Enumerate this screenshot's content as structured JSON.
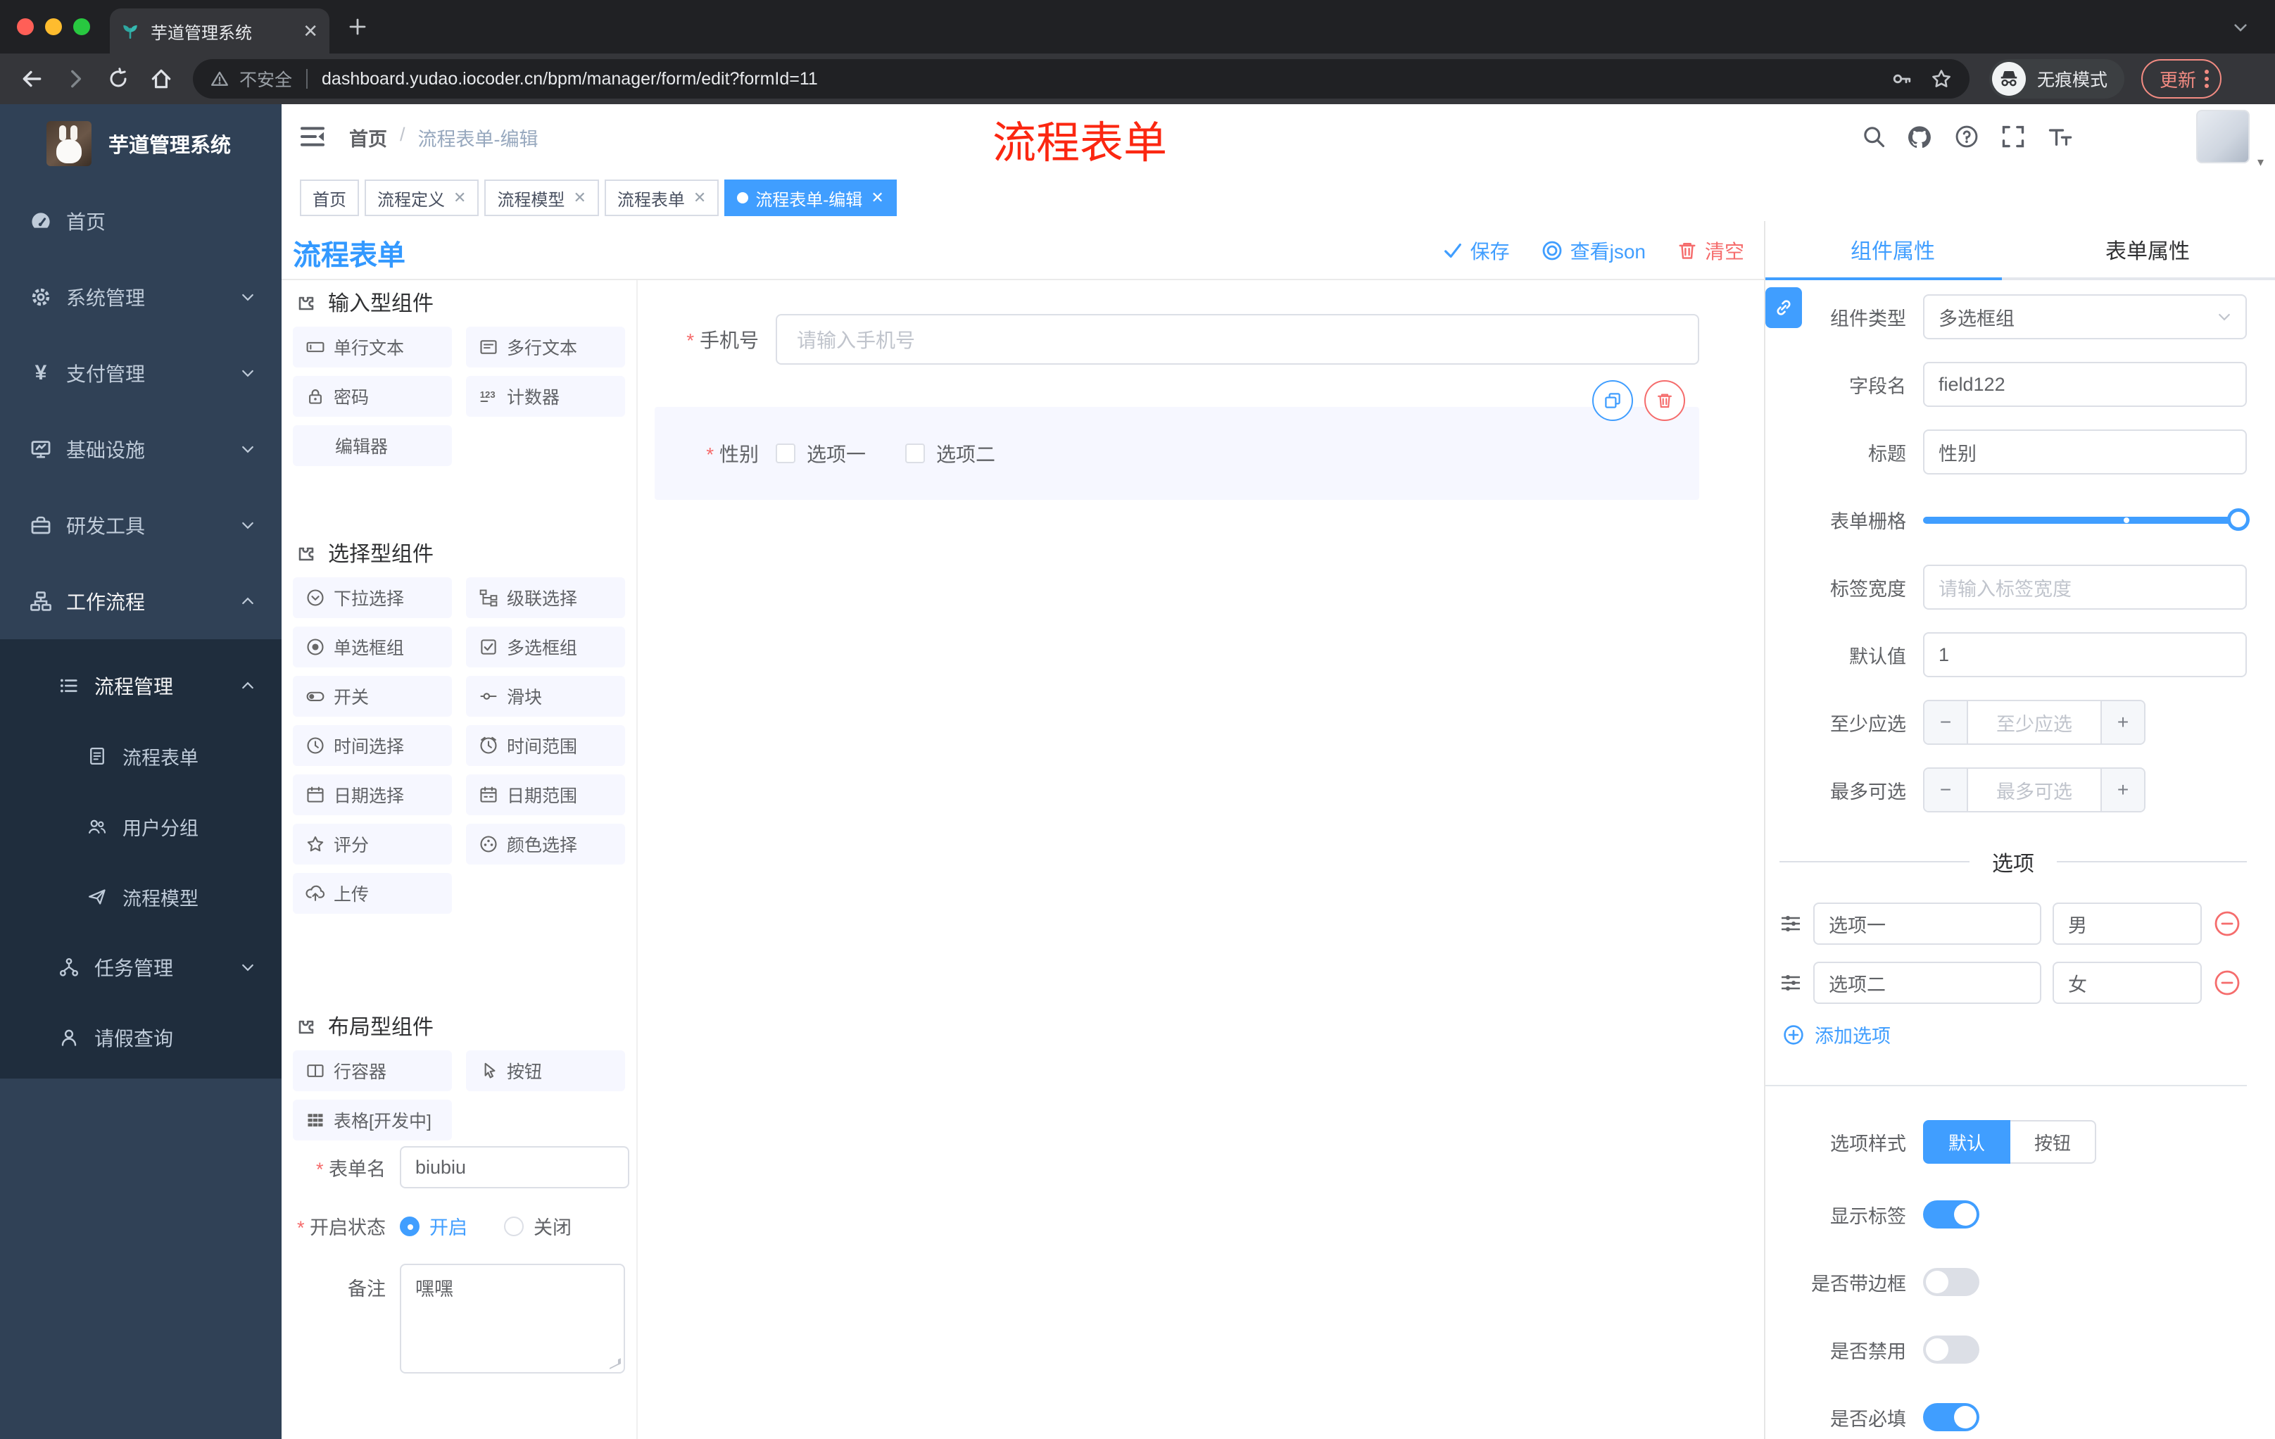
{
  "browser": {
    "tab_title": "芋道管理系统",
    "security": "不安全",
    "url": "dashboard.yudao.iocoder.cn/bpm/manager/form/edit?formId=11",
    "incognito": "无痕模式",
    "update": "更新"
  },
  "sidebar": {
    "brand": "芋道管理系统",
    "items": {
      "home": "首页",
      "system": "系统管理",
      "pay": "支付管理",
      "infra": "基础设施",
      "dev": "研发工具",
      "workflow": "工作流程",
      "flowmgr": "流程管理",
      "flowform": "流程表单",
      "usergroup": "用户分组",
      "flowmodel": "流程模型",
      "taskmgr": "任务管理",
      "leave": "请假查询"
    }
  },
  "header": {
    "breadcrumb_home": "首页",
    "breadcrumb_sep": "/",
    "breadcrumb_current": "流程表单-编辑",
    "annotation": "流程表单"
  },
  "tags": {
    "t1": "首页",
    "t2": "流程定义",
    "t3": "流程模型",
    "t4": "流程表单",
    "t5": "流程表单-编辑"
  },
  "designer": {
    "title": "流程表单",
    "actions": {
      "save": "保存",
      "view_json": "查看json",
      "clear": "清空"
    },
    "palette": {
      "g1": {
        "title": "输入型组件",
        "items": [
          "单行文本",
          "多行文本",
          "密码",
          "计数器",
          "编辑器"
        ]
      },
      "g2": {
        "title": "选择型组件",
        "items": [
          "下拉选择",
          "级联选择",
          "单选框组",
          "多选框组",
          "开关",
          "滑块",
          "时间选择",
          "时间范围",
          "日期选择",
          "日期范围",
          "评分",
          "颜色选择",
          "上传"
        ]
      },
      "g3": {
        "title": "布局型组件",
        "items": [
          "行容器",
          "按钮",
          "表格[开发中]"
        ]
      }
    },
    "meta": {
      "name_label": "表单名",
      "name_value": "biubiu",
      "status_label": "开启状态",
      "status_on": "开启",
      "status_off": "关闭",
      "remark_label": "备注",
      "remark_value": "嘿嘿"
    },
    "canvas": {
      "phone_label": "手机号",
      "phone_placeholder": "请输入手机号",
      "gender_label": "性别",
      "gender_opt1": "选项一",
      "gender_opt2": "选项二"
    }
  },
  "panel": {
    "tab_component": "组件属性",
    "tab_form": "表单属性",
    "type_label": "组件类型",
    "type_value": "多选框组",
    "field_label": "字段名",
    "field_value": "field122",
    "title_label": "标题",
    "title_value": "性别",
    "grid_label": "表单栅格",
    "labelwidth_label": "标签宽度",
    "labelwidth_placeholder": "请输入标签宽度",
    "default_label": "默认值",
    "default_value": "1",
    "min_label": "至少应选",
    "min_placeholder": "至少应选",
    "max_label": "最多可选",
    "max_placeholder": "最多可选",
    "options_divider": "选项",
    "opt1_label": "选项一",
    "opt1_value": "男",
    "opt2_label": "选项二",
    "opt2_value": "女",
    "add_option": "添加选项",
    "style_label": "选项样式",
    "style_default": "默认",
    "style_button": "按钮",
    "toggle_showlabel": "显示标签",
    "toggle_border": "是否带边框",
    "toggle_disabled": "是否禁用",
    "toggle_required": "是否必填"
  },
  "colors": {
    "accent": "#409eff",
    "danger": "#f56c6c",
    "sidebar": "#304156",
    "sidebar_sub": "#1f2d3d"
  }
}
